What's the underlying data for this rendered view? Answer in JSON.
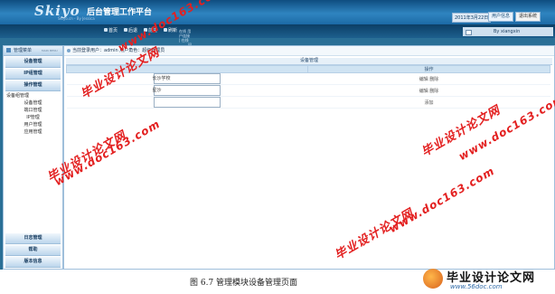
{
  "app": {
    "logo": "Skiyo",
    "tagline": "Skiyo.cn - By Jessica",
    "title": "后台管理工作平台",
    "date": "2011年3月22日",
    "user_button": "用户信息",
    "exit_button": "退出系统"
  },
  "toolbar": {
    "nav": [
      "首页",
      "后退",
      "前进",
      "刷新"
    ],
    "extra_line1": "在线 用户连接 | 在线",
    "extra_line2": "问卷",
    "welcome": "By xiangxin"
  },
  "sidebar": {
    "header": "管理菜单",
    "header_sub": "MAIN MENU",
    "sections": [
      "设备管理",
      "IP组管理",
      "操作管理"
    ],
    "sub_items": [
      "设备组管理",
      "设备管理",
      "端口管理",
      "IP管理",
      "用户管理",
      "应用管理"
    ],
    "bottom_sections": [
      "日志管理",
      "帮助",
      "版本信息"
    ]
  },
  "main": {
    "breadcrumb": "当前登录用户：admin  用户角色：超级管理员",
    "panel_title": "设备管理",
    "columns": [
      "",
      "操作"
    ],
    "rows": [
      {
        "name": "长沙学校",
        "op": "编辑  删除"
      },
      {
        "name": "星沙",
        "op": "编辑  删除"
      },
      {
        "name": "",
        "op": "添加"
      }
    ]
  },
  "watermarks": {
    "cn": "毕业设计论文网",
    "url": "www.doc163.com"
  },
  "caption": "图 6.7 管理模块设备管理页面",
  "brand": {
    "cn": "毕业设计论文网",
    "url": "www.56doc.com"
  }
}
